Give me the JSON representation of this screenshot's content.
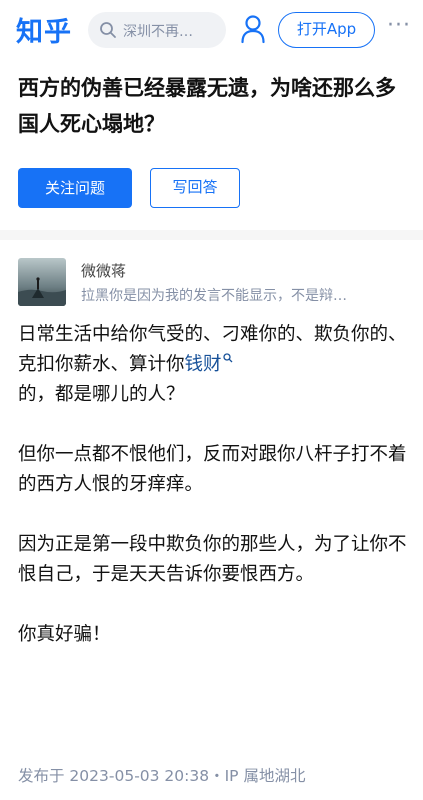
{
  "header": {
    "logo": "知乎",
    "search_placeholder": "深圳不再…",
    "open_app_label": "打开App",
    "more_label": "···"
  },
  "question": {
    "title": "西方的伪善已经暴露无遗，为啥还那么多国人死心塌地？",
    "follow_label": "关注问题",
    "answer_label": "写回答"
  },
  "answer": {
    "author_name": "微微蒋",
    "author_bio": "拉黑你是因为我的发言不能显示，不是辩…",
    "p1_a": "日常生活中给你气受的、刁难你的、欺负你的、克扣你薪水、算计你",
    "p1_link": "钱财",
    "p1_b": "的，都是哪儿的人？",
    "p2": "但你一点都不恨他们，反而对跟你八杆子打不着的西方人恨的牙痒痒。",
    "p3": "因为正是第一段中欺负你的那些人，为了让你不恨自己，于是天天告诉你要恨西方。",
    "p4": "你真好骗！",
    "meta": "发布于 2023-05-03 20:38・IP 属地湖北"
  },
  "colors": {
    "brand": "#1772f6",
    "link": "#175199",
    "muted": "#8590a6"
  }
}
